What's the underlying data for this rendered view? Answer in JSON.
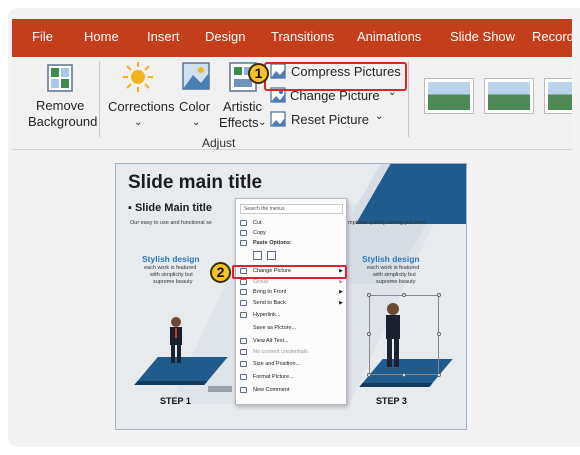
{
  "ribbon": {
    "tabs": [
      "File",
      "Home",
      "Insert",
      "Design",
      "Transitions",
      "Animations",
      "Slide Show",
      "Record"
    ],
    "commands": {
      "remove_background": [
        "Remove",
        "Background"
      ],
      "corrections": "Corrections",
      "color": "Color",
      "artistic_effects": [
        "Artistic",
        "Effects"
      ],
      "compress_pictures": "Compress Pictures",
      "change_picture": "Change Picture",
      "reset_picture": "Reset Picture",
      "group_label": "Adjust"
    },
    "step_badge": "1",
    "accent_color": "#c43e1c",
    "highlight_color": "#e5202e"
  },
  "slide": {
    "title": "Slide main title",
    "bullet": "Slide Main title",
    "desc_left": "Our easy to use and functional se",
    "desc_right": "mplates quickly  saving you time.",
    "left_heading": "Stylish design",
    "left_text": [
      "each work is featured",
      "with simplicity but",
      "supreme beauty"
    ],
    "right_heading": "Stylish design",
    "right_text": [
      "each work is featured",
      "with simplicity but",
      "supreme beauty"
    ],
    "step_left": "STEP 1",
    "step_right": "STEP 3",
    "step_badge": "2"
  },
  "context_menu": {
    "search_placeholder": "Search the menus",
    "items": {
      "cut": "Cut",
      "copy": "Copy",
      "paste_options": "Paste Options:",
      "change_picture": "Change Picture",
      "group": "Group",
      "bring_to_front": "Bring to Front",
      "send_to_back": "Send to Back",
      "hyperlink": "Hyperlink...",
      "save_as_picture": "Save as Picture...",
      "view_alt_text": "View Alt Text...",
      "no_content_credentials": "No content credentials",
      "size_and_position": "Size and Position...",
      "format_picture": "Format Picture...",
      "new_comment": "New Comment"
    }
  }
}
